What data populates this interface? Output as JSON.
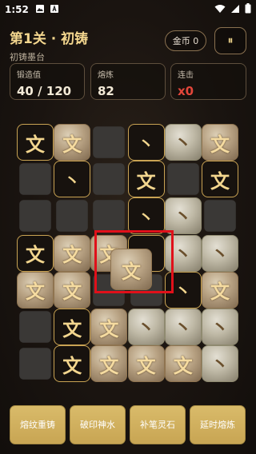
{
  "status_bar": {
    "time": "1:52"
  },
  "header": {
    "title": "第1关 · 初铸",
    "subtitle": "初铸墨台"
  },
  "coins": {
    "label": "金币 0"
  },
  "pause": {
    "label": "⏸"
  },
  "stats": [
    {
      "label": "锻造值",
      "value": "40 / 120"
    },
    {
      "label": "熔炼",
      "value": "82"
    },
    {
      "label": "连击",
      "value": "x0"
    }
  ],
  "board": {
    "rows": 7,
    "cols": 6,
    "tiles": [
      [
        "dark:文",
        "gold:文",
        "empty",
        "dark:丶",
        "silver:丶",
        "gold:文"
      ],
      [
        "empty",
        "dark:丶",
        "empty",
        "dark:文",
        "empty",
        "dark:文"
      ],
      [
        "empty",
        "empty",
        "empty",
        "dark:丶",
        "silver:丶",
        "empty"
      ],
      [
        "dark:文",
        "gold:文",
        "gold:文",
        "dark:丶",
        "silver:丶",
        "silver:丶"
      ],
      [
        "gold:文",
        "gold:文",
        "empty",
        "empty",
        "dark:丶",
        "gold:文"
      ],
      [
        "empty",
        "dark:文",
        "gold:文",
        "silver:丶",
        "silver:丶",
        "silver:丶"
      ],
      [
        "empty",
        "dark:文",
        "gold:文",
        "gold:文",
        "gold:文",
        "silver:丶"
      ]
    ]
  },
  "dragged_tile": {
    "char": "文"
  },
  "actions": [
    "熔纹重铸",
    "破印神水",
    "补笔灵石",
    "延时熔炼"
  ]
}
